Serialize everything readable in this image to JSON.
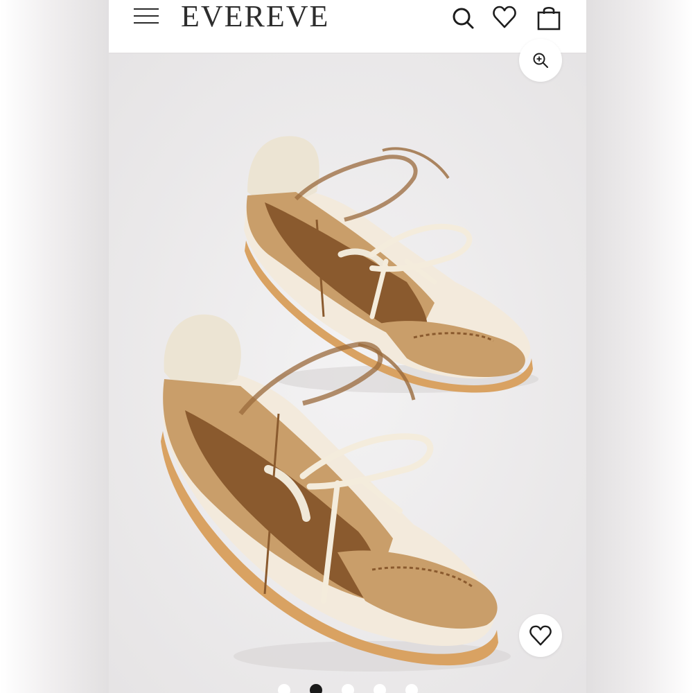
{
  "header": {
    "brand": "EVEREVE",
    "icons": [
      "menu-icon",
      "search-icon",
      "heart-icon",
      "shopping-bag-icon"
    ]
  },
  "gallery": {
    "zoom_icon": "zoom-in-icon",
    "wishlist_icon": "heart-icon",
    "slide_count": 5,
    "active_slide": 2
  },
  "colors": {
    "suede_dark": "#8a5a2e",
    "suede_light": "#c99e6a",
    "cream": "#ece4d3",
    "sole_gum": "#d9a262",
    "ribbon": "#9a6a3c"
  }
}
